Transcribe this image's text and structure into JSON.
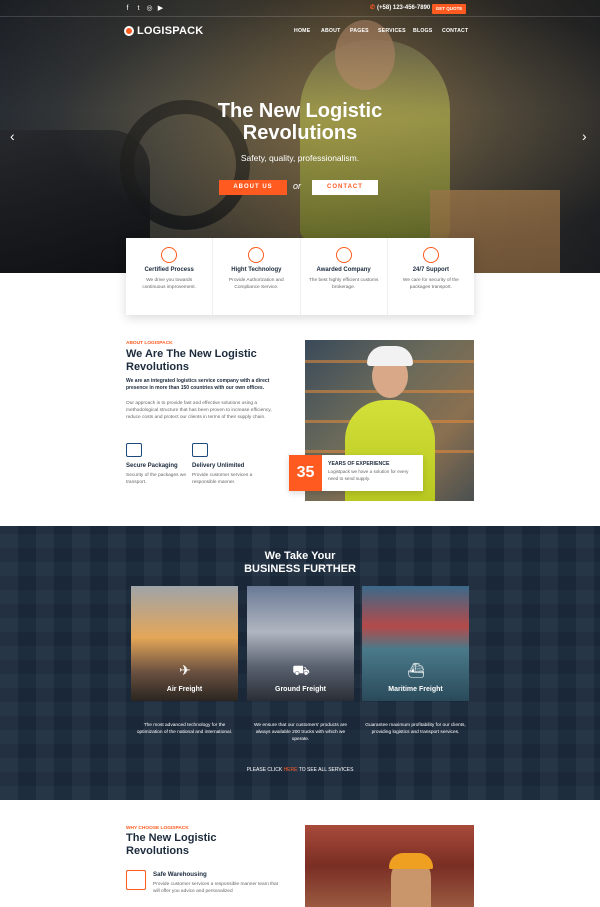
{
  "topbar": {
    "social": [
      "f",
      "t",
      "◎",
      "▶"
    ],
    "phone": "(+58) 123-456-7890",
    "quote_label": "GET QUOTE"
  },
  "brand": {
    "logo_text": "LOGISPACK",
    "accent": "#ff5a1f",
    "navy": "#1c2b3d"
  },
  "nav": [
    "HOME",
    "ABOUT",
    "PAGES",
    "SERVICES",
    "BLOGS",
    "CONTACT"
  ],
  "hero": {
    "title_line1": "The New Logistic",
    "title_line2": "Revolutions",
    "subtitle": "Safety, quality, professionalism.",
    "about_label": "ABOUT US",
    "or_label": "or",
    "contact_label": "CONTACT",
    "prev_icon": "chevron-left-icon",
    "next_icon": "chevron-right-icon"
  },
  "features": [
    {
      "title": "Certified Process",
      "desc": "We drive you towards continuous improvement.",
      "icon": "gear-icon"
    },
    {
      "title": "Hight Technology",
      "desc": "Provide Authorization and Compliance Service.",
      "icon": "award-icon"
    },
    {
      "title": "Awarded Company",
      "desc": "The best highly efficient customs brokerage.",
      "icon": "medal-icon"
    },
    {
      "title": "24/7 Support",
      "desc": "We care for security of the packages transport.",
      "icon": "headset-icon"
    }
  ],
  "about": {
    "tag": "ABOUT LOGISPACK",
    "title_line1": "We Are The New Logistic",
    "title_line2": "Revolutions",
    "lead": "We are an integrated logistics service company with a direct presence in more than 150 countries with our own offices.",
    "text": "Our approach is to provide fast and effective solutions using a methodological structure that has been proven to increase efficiency, reduce costs and protect our clients in terms of their supply chain.",
    "services": [
      {
        "title": "Secure Packaging",
        "desc": "Security of the packages we transport.",
        "icon": "package-icon"
      },
      {
        "title": "Delivery Unlimited",
        "desc": "Provide customer services a responsible manner.",
        "icon": "delivery-icon"
      }
    ],
    "experience": {
      "number": "35",
      "title": "YEARS OF EXPERIENCE",
      "desc": "Logistpack we have a solution for every need to send supply."
    }
  },
  "further": {
    "title_line1": "We Take Your",
    "title_line2": "BUSINESS FURTHER",
    "cards": [
      {
        "name": "Air Freight",
        "icon": "airplane-icon",
        "desc": "The most advanced technology for the optimization of the national and international."
      },
      {
        "name": "Ground Freight",
        "icon": "truck-icon",
        "desc": "We ensure that our customers' products are always available 200 trucks with which we operate."
      },
      {
        "name": "Maritime Freight",
        "icon": "ship-icon",
        "desc": "Guarantee maximum profitability for our clients, providing logistics and transport services."
      }
    ],
    "see_all_pre": "PLEASE CLICK ",
    "see_all_link": "HERE",
    "see_all_post": " TO SEE ALL SERVICES"
  },
  "why": {
    "tag": "WHY CHOOSE LOGISPACK",
    "title_line1": "The New Logistic",
    "title_line2": "Revolutions",
    "item_title": "Safe Warehousing",
    "item_desc": "Provide customer services a responsible manner team that will offer you advice and personalized"
  }
}
